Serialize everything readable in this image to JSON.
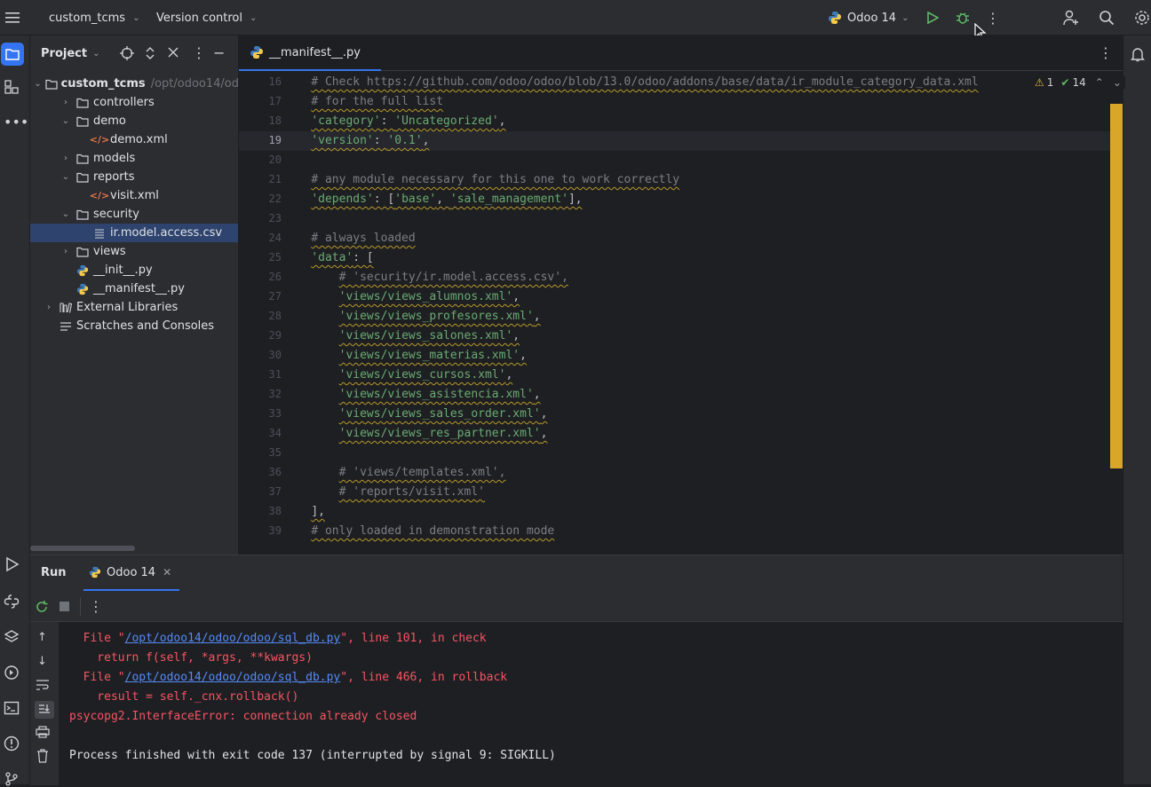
{
  "titlebar": {
    "project": "custom_tcms",
    "vcs": "Version control",
    "run_config": "Odoo 14"
  },
  "project_panel": {
    "title": "Project",
    "items": [
      {
        "label": "custom_tcms",
        "hint": "/opt/odoo14/od",
        "indent": 0,
        "type": "folder",
        "expanded": true
      },
      {
        "label": "controllers",
        "indent": 1,
        "type": "folder",
        "expanded": false
      },
      {
        "label": "demo",
        "indent": 1,
        "type": "folder",
        "expanded": true
      },
      {
        "label": "demo.xml",
        "indent": 2,
        "type": "xml"
      },
      {
        "label": "models",
        "indent": 1,
        "type": "folder",
        "expanded": false
      },
      {
        "label": "reports",
        "indent": 1,
        "type": "folder",
        "expanded": true
      },
      {
        "label": "visit.xml",
        "indent": 2,
        "type": "xml"
      },
      {
        "label": "security",
        "indent": 1,
        "type": "folder",
        "expanded": true
      },
      {
        "label": "ir.model.access.csv",
        "indent": 2,
        "type": "csv",
        "selected": true
      },
      {
        "label": "views",
        "indent": 1,
        "type": "folder",
        "expanded": false
      },
      {
        "label": "__init__.py",
        "indent": 1,
        "type": "py"
      },
      {
        "label": "__manifest__.py",
        "indent": 1,
        "type": "py"
      },
      {
        "label": "External Libraries",
        "indent": 0,
        "type": "lib",
        "expanded": false
      },
      {
        "label": "Scratches and Consoles",
        "indent": 0,
        "type": "scratch"
      }
    ]
  },
  "editor": {
    "tab_label": "__manifest__.py",
    "warnings": "1",
    "checks": "14",
    "current_line": "19",
    "lines": [
      {
        "n": "16",
        "text": "    # Check https://github.com/odoo/odoo/blob/13.0/odoo/addons/base/data/ir_module_category_data.xml",
        "kind": "comment"
      },
      {
        "n": "17",
        "text": "    # for the full list",
        "kind": "comment"
      },
      {
        "n": "18",
        "text": "    'category': 'Uncategorized',",
        "kind": "kv"
      },
      {
        "n": "19",
        "text": "    'version': '0.1',",
        "kind": "kv"
      },
      {
        "n": "20",
        "text": "",
        "kind": "blank"
      },
      {
        "n": "21",
        "text": "    # any module necessary for this one to work correctly",
        "kind": "comment"
      },
      {
        "n": "22",
        "text": "    'depends': ['base', 'sale_management'],",
        "kind": "kv"
      },
      {
        "n": "23",
        "text": "",
        "kind": "blank"
      },
      {
        "n": "24",
        "text": "    # always loaded",
        "kind": "comment"
      },
      {
        "n": "25",
        "text": "    'data': [",
        "kind": "kv"
      },
      {
        "n": "26",
        "text": "        # 'security/ir.model.access.csv',",
        "kind": "comment"
      },
      {
        "n": "27",
        "text": "        'views/views_alumnos.xml',",
        "kind": "str"
      },
      {
        "n": "28",
        "text": "        'views/views_profesores.xml',",
        "kind": "str"
      },
      {
        "n": "29",
        "text": "        'views/views_salones.xml',",
        "kind": "str"
      },
      {
        "n": "30",
        "text": "        'views/views_materias.xml',",
        "kind": "str"
      },
      {
        "n": "31",
        "text": "        'views/views_cursos.xml',",
        "kind": "str"
      },
      {
        "n": "32",
        "text": "        'views/views_asistencia.xml',",
        "kind": "str"
      },
      {
        "n": "33",
        "text": "        'views/views_sales_order.xml',",
        "kind": "str"
      },
      {
        "n": "34",
        "text": "        'views/views_res_partner.xml',",
        "kind": "str"
      },
      {
        "n": "35",
        "text": "",
        "kind": "blank"
      },
      {
        "n": "36",
        "text": "        # 'views/templates.xml',",
        "kind": "comment"
      },
      {
        "n": "37",
        "text": "        # 'reports/visit.xml'",
        "kind": "comment"
      },
      {
        "n": "38",
        "text": "    ],",
        "kind": "plain"
      },
      {
        "n": "39",
        "text": "    # only loaded in demonstration mode",
        "kind": "comment"
      }
    ]
  },
  "run_panel": {
    "title": "Run",
    "tab_label": "Odoo 14",
    "output": [
      {
        "kind": "err",
        "parts": [
          {
            "t": "  File \""
          },
          {
            "t": "/opt/odoo14/odoo/odoo/sql_db.py",
            "link": true
          },
          {
            "t": "\", line 101, in check"
          }
        ]
      },
      {
        "kind": "err",
        "parts": [
          {
            "t": "    return f(self, *args, **kwargs)"
          }
        ]
      },
      {
        "kind": "err",
        "parts": [
          {
            "t": "  File \""
          },
          {
            "t": "/opt/odoo14/odoo/odoo/sql_db.py",
            "link": true
          },
          {
            "t": "\", line 466, in rollback"
          }
        ]
      },
      {
        "kind": "err",
        "parts": [
          {
            "t": "    result = self._cnx.rollback()"
          }
        ]
      },
      {
        "kind": "err",
        "parts": [
          {
            "t": "psycopg2.InterfaceError: connection already closed"
          }
        ]
      },
      {
        "kind": "blank",
        "parts": [
          {
            "t": ""
          }
        ]
      },
      {
        "kind": "plain",
        "parts": [
          {
            "t": "Process finished with exit code 137 (interrupted by signal 9: SIGKILL)"
          }
        ]
      }
    ]
  }
}
